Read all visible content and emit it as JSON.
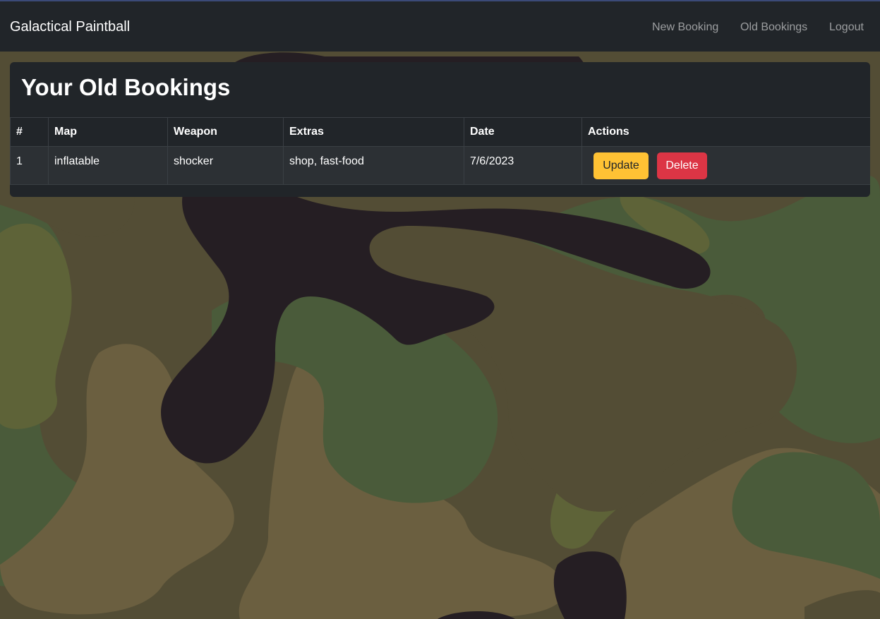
{
  "navbar": {
    "brand": "Galactical Paintball",
    "links": [
      {
        "label": "New Booking"
      },
      {
        "label": "Old Bookings"
      },
      {
        "label": "Logout"
      }
    ]
  },
  "page": {
    "title": "Your Old Bookings"
  },
  "table": {
    "headers": [
      "#",
      "Map",
      "Weapon",
      "Extras",
      "Date",
      "Actions"
    ],
    "rows": [
      {
        "index": "1",
        "map": "inflatable",
        "weapon": "shocker",
        "extras": "shop, fast-food",
        "date": "7/6/2023",
        "update_label": "Update",
        "delete_label": "Delete"
      }
    ]
  },
  "colors": {
    "navbar_bg": "#212529",
    "card_bg": "#212529",
    "update_button": "#ffc234",
    "delete_button": "#dc3545",
    "camo_dark": "#251e23",
    "camo_green": "#4a5b3a",
    "camo_olive": "#5e6338",
    "camo_tan": "#6b5f40",
    "camo_brown": "#534d35"
  }
}
